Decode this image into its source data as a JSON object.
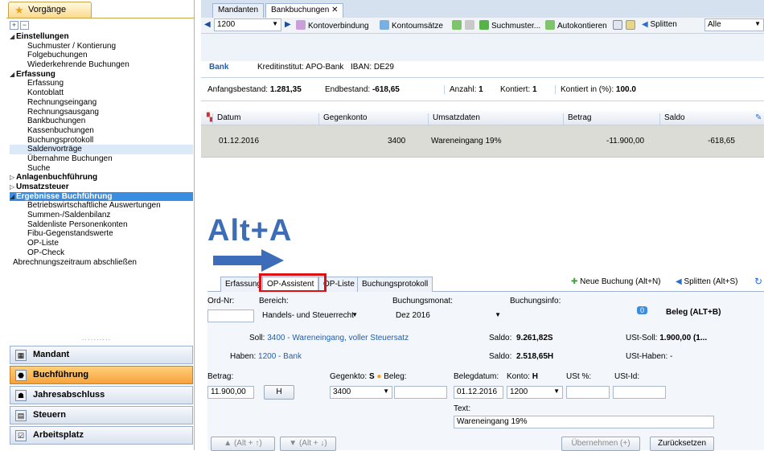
{
  "left": {
    "tab_label": "Vorgänge",
    "tree": [
      {
        "label": "Einstellungen",
        "level": 0,
        "expanded": true
      },
      {
        "label": "Suchmuster / Kontierung",
        "level": 1
      },
      {
        "label": "Folgebuchungen",
        "level": 1
      },
      {
        "label": "Wiederkehrende Buchungen",
        "level": 1
      },
      {
        "label": "Erfassung",
        "level": 0,
        "expanded": true
      },
      {
        "label": "Erfassung",
        "level": 1
      },
      {
        "label": "Kontoblatt",
        "level": 1
      },
      {
        "label": "Rechnungseingang",
        "level": 1
      },
      {
        "label": "Rechnungsausgang",
        "level": 1
      },
      {
        "label": "Bankbuchungen",
        "level": 1
      },
      {
        "label": "Kassenbuchungen",
        "level": 1
      },
      {
        "label": "Buchungsprotokoll",
        "level": 1
      },
      {
        "label": "Saldenvorträge",
        "level": 1,
        "highlight": true
      },
      {
        "label": "Übernahme Buchungen",
        "level": 1
      },
      {
        "label": "Suche",
        "level": 1
      },
      {
        "label": "Anlagenbuchführung",
        "level": 0,
        "expanded": false
      },
      {
        "label": "Umsatzsteuer",
        "level": 0,
        "expanded": false
      },
      {
        "label": "Ergebnisse Buchführung",
        "level": 0,
        "expanded": true,
        "selected": true
      },
      {
        "label": "Betriebswirtschaftliche Auswertungen",
        "level": 1
      },
      {
        "label": "Summen-/Saldenbilanz",
        "level": 1
      },
      {
        "label": "Saldenliste Personenkonten",
        "level": 1
      },
      {
        "label": "Fibu-Gegenstandswerte",
        "level": 1
      },
      {
        "label": "OP-Liste",
        "level": 1
      },
      {
        "label": "OP-Check",
        "level": 1
      },
      {
        "label": "Abrechnungszeitraum abschließen",
        "level": "plain"
      }
    ],
    "nav": [
      "Mandant",
      "Buchführung",
      "Jahresabschluss",
      "Steuern",
      "Arbeitsplatz"
    ],
    "nav_active": "Buchführung"
  },
  "tabs": {
    "mandanten": "Mandanten",
    "bank": "Bankbuchungen",
    "close": "✕"
  },
  "toolbar": {
    "account": "1200",
    "kontoverbindung": "Kontoverbindung",
    "kontoumsaetze": "Kontoumsätze",
    "suchmuster": "Suchmuster...",
    "autokontieren": "Autokontieren",
    "splitten": "Splitten",
    "filter": "Alle"
  },
  "bank": {
    "name": "Bank",
    "kreditinstitut": "Kreditinstitut: APO-Bank",
    "iban": "IBAN: DE29"
  },
  "info": {
    "anfang_label": "Anfangsbestand:",
    "anfang": "1.281,35",
    "end_label": "Endbestand:",
    "end": "-618,65",
    "anzahl_label": "Anzahl:",
    "anzahl": "1",
    "kontiert_label": "Kontiert:",
    "kontiert": "1",
    "pct_label": "Kontiert in (%):",
    "pct": "100.0"
  },
  "grid": {
    "headers": {
      "datum": "Datum",
      "gegenkonto": "Gegenkonto",
      "umsatz": "Umsatzdaten",
      "betrag": "Betrag",
      "saldo": "Saldo"
    },
    "row": {
      "datum": "01.12.2016",
      "gegenkonto": "3400",
      "umsatz": "Wareneingang 19%",
      "betrag": "-11.900,00",
      "saldo": "-618,65"
    }
  },
  "overlay": {
    "shortcut": "Alt+A"
  },
  "panel": {
    "tabs": [
      "Erfassung",
      "OP-Assistent",
      "OP-Liste",
      "Buchungsprotokoll"
    ],
    "neue_buchung": "Neue Buchung (Alt+N)",
    "splitten": "Splitten (Alt+S)"
  },
  "form": {
    "ordnr_label": "Ord-Nr:",
    "bereich_label": "Bereich:",
    "bereich": "Handels- und Steuerrecht",
    "monat_label": "Buchungsmonat:",
    "monat": "Dez 2016",
    "info_label": "Buchungsinfo:",
    "beleg_badge": "0",
    "beleg_btn": "Beleg (ALT+B)",
    "soll_label": "Soll:",
    "soll_link": "3400 - Wareneingang, voller Steuersatz",
    "saldo_label": "Saldo:",
    "soll_saldo": "9.261,82S",
    "ust_soll_label": "USt-Soll:",
    "ust_soll": "1.900,00 (1...",
    "haben_label": "Haben:",
    "haben_link": "1200 - Bank",
    "haben_saldo": "2.518,65H",
    "ust_haben_label": "USt-Haben:",
    "ust_haben": "-",
    "betrag_label": "Betrag:",
    "betrag": "11.900,00",
    "sh_btn": "H",
    "gegenkto_label": "Gegenkto:",
    "gegenkto_s": "S",
    "beleg_label": "Beleg:",
    "gegenkto": "3400",
    "belegdatum_label": "Belegdatum:",
    "belegdatum": "01.12.2016",
    "konto_label": "Konto:",
    "konto_h": "H",
    "konto": "1200",
    "ust_label": "USt %:",
    "ustid_label": "USt-Id:",
    "text_label": "Text:",
    "text": "Wareneingang 19%",
    "prev_btn": "(Alt + ↑)",
    "next_btn": "(Alt + ↓)",
    "uebernehmen": "Übernehmen (+)",
    "zuruecksetzen": "Zurücksetzen"
  }
}
